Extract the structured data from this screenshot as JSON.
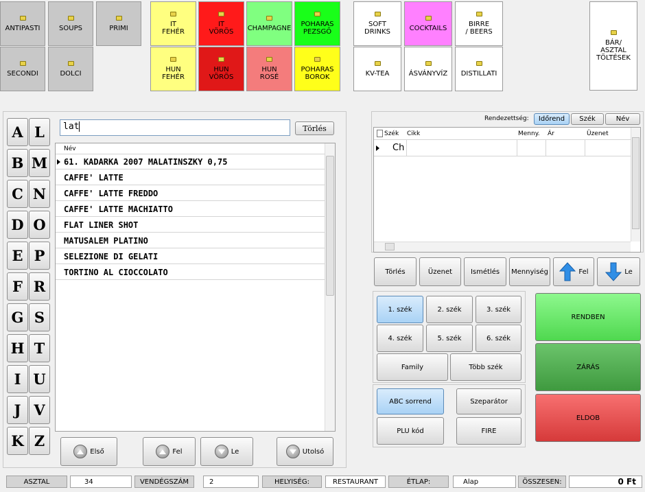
{
  "categories": [
    {
      "label": "ANTIPASTI",
      "color": "#c8c8c8"
    },
    {
      "label": "SOUPS",
      "color": "#c8c8c8"
    },
    {
      "label": "PRIMI",
      "color": "#c8c8c8"
    },
    {
      "label": "SECONDI",
      "color": "#c8c8c8"
    },
    {
      "label": "DOLCI",
      "color": "#c8c8c8"
    },
    {
      "label": "IT\nFEHÉR",
      "color": "#ffff80"
    },
    {
      "label": "IT\nVÖRÖS",
      "color": "#ff1a1a"
    },
    {
      "label": "CHAMPAGNE",
      "color": "#80ff80"
    },
    {
      "label": "POHARAS\nPEZSGŐ",
      "color": "#19ff19"
    },
    {
      "label": "HUN\nFEHÉR",
      "color": "#ffff80"
    },
    {
      "label": "HUN\nVÖRÖS",
      "color": "#e01818"
    },
    {
      "label": "HUN\nROSÉ",
      "color": "#f47c7c"
    },
    {
      "label": "POHARAS\nBOROK",
      "color": "#ffff1a"
    },
    {
      "label": "SOFT\nDRINKS",
      "color": "#ffffff"
    },
    {
      "label": "COCKTAILS",
      "color": "#ff80ff"
    },
    {
      "label": "BIRRE\n/ BEERS",
      "color": "#ffffff"
    },
    {
      "label": "KV-TEA",
      "color": "#ffffff"
    },
    {
      "label": "ÁSVÁNYVÍZ",
      "color": "#ffffff"
    },
    {
      "label": "DISTILLATI",
      "color": "#ffffff"
    },
    {
      "label": "BÁR/\nASZTAL\nTÖLTÉSEK",
      "color": "#ffffff"
    }
  ],
  "letters": [
    "A",
    "L",
    "B",
    "M",
    "C",
    "N",
    "D",
    "O",
    "E",
    "P",
    "F",
    "R",
    "G",
    "S",
    "H",
    "T",
    "I",
    "U",
    "J",
    "V",
    "K",
    "Z"
  ],
  "search": {
    "value": "lat",
    "clear_label": "Törlés"
  },
  "list": {
    "header": "Név",
    "items": [
      "61. KADARKA 2007 MALATINSZKY 0,75",
      "CAFFE' LATTE",
      "CAFFE' LATTE FREDDO",
      "CAFFE' LATTE MACHIATTO",
      "FLAT LINER SHOT",
      "MATUSALEM PLATINO",
      "SELEZIONE DI GELATI",
      "TORTINO AL CIOCCOLATO"
    ]
  },
  "nav": {
    "first": "Első",
    "up": "Fel",
    "down": "Le",
    "last": "Utolsó"
  },
  "sort": {
    "label": "Rendezettség:",
    "options": [
      "Időrend",
      "Szék",
      "Név"
    ]
  },
  "order_table": {
    "columns": [
      "Szék",
      "Cikk",
      "Menny.",
      "Ár",
      "Üzenet"
    ],
    "rows": [
      {
        "seat": "Ch",
        "item": "",
        "qty": "",
        "price": "",
        "msg": ""
      }
    ]
  },
  "actions": {
    "delete": "Törlés",
    "message": "Üzenet",
    "repeat": "Ismétlés",
    "quantity": "Mennyiség",
    "up": "Fel",
    "down": "Le"
  },
  "seats": [
    "1. szék",
    "2. szék",
    "3. szék",
    "4. szék",
    "5. szék",
    "6. szék"
  ],
  "seat_extra": {
    "family": "Family",
    "multi": "Több szék"
  },
  "misc": {
    "abc": "ABC sorrend",
    "separator": "Szeparátor",
    "plu": "PLU kód",
    "fire": "FIRE"
  },
  "main_actions": {
    "ok": "RENDBEN",
    "close": "ZÁRÁS",
    "discard": "ELDOB"
  },
  "status": {
    "table_label": "ASZTAL",
    "table_value": "34",
    "guests_label": "VENDÉGSZÁM",
    "guests_value": "2",
    "location_label": "HELYISÉG:",
    "location_value": "RESTAURANT",
    "menu_label": "ÉTLAP:",
    "menu_value": "Alap",
    "total_label": "ÖSSZESEN:",
    "total_value": "0 Ft"
  }
}
